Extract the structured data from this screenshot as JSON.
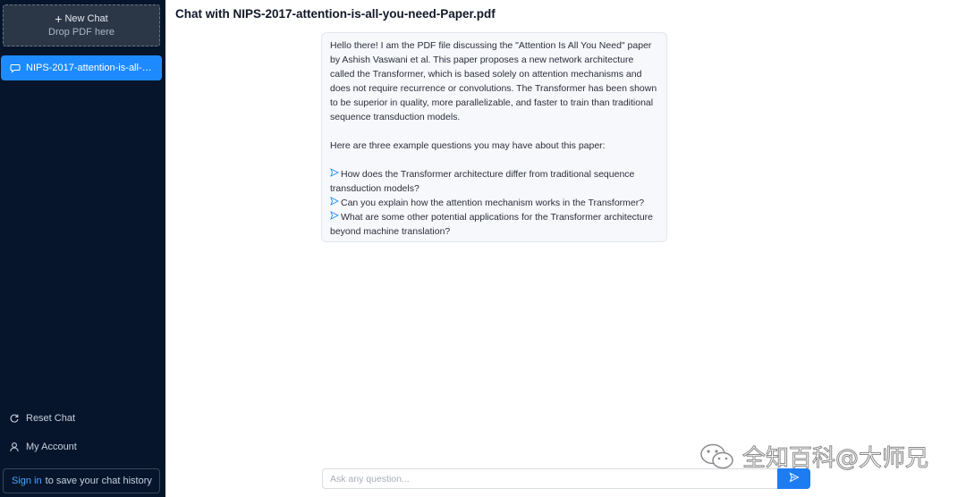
{
  "sidebar": {
    "new_chat_label": "New Chat",
    "drop_hint": "Drop PDF here",
    "active_chat_label": "NIPS-2017-attention-is-all-you-need-Paper.pdf",
    "reset_chat_label": "Reset Chat",
    "my_account_label": "My Account",
    "sign_in_link": "Sign in",
    "sign_in_suffix": "to save your chat history"
  },
  "main": {
    "title": "Chat with NIPS-2017-attention-is-all-you-need-Paper.pdf",
    "message": {
      "intro": "Hello there! I am the PDF file discussing the \"Attention Is All You Need\" paper by Ashish Vaswani et al. This paper proposes a new network architecture called the Transformer, which is based solely on attention mechanisms and does not require recurrence or convolutions. The Transformer has been shown to be superior in quality, more parallelizable, and faster to train than traditional sequence transduction models.",
      "lead_in": "Here are three example questions you may have about this paper:",
      "questions": [
        "How does the Transformer architecture differ from traditional sequence transduction models?",
        "Can you explain how the attention mechanism works in the Transformer?",
        "What are some other potential applications for the Transformer architecture beyond machine translation?"
      ]
    }
  },
  "composer": {
    "placeholder": "Ask any question...",
    "value": ""
  },
  "watermark": {
    "text": "全知百科@大师兄"
  },
  "colors": {
    "sidebar_bg": "#06152b",
    "accent": "#1d8bff",
    "send_button": "#1d7cf2"
  }
}
